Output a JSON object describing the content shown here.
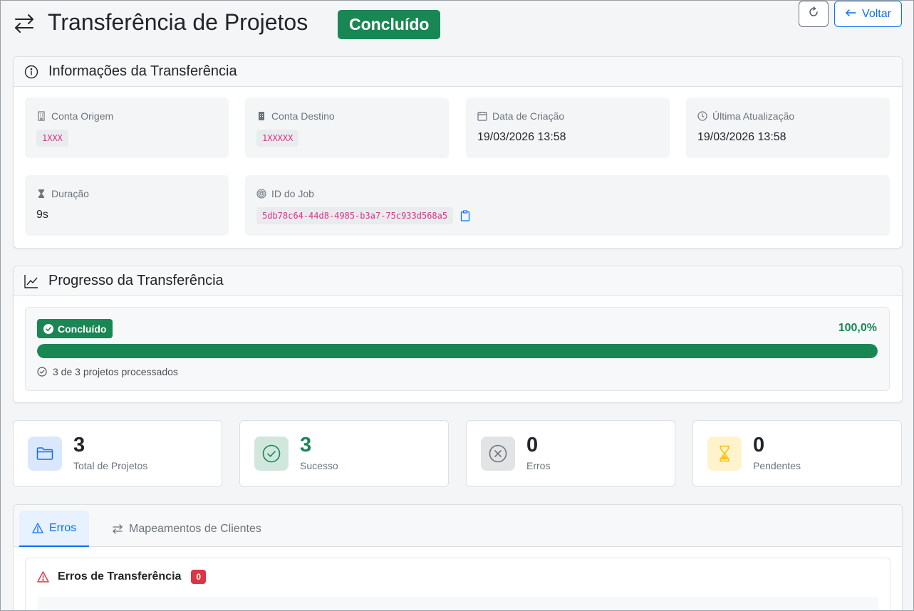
{
  "header": {
    "title": "Transferência de Projetos",
    "status": "Concluído",
    "back_label": "Voltar"
  },
  "info": {
    "title": "Informações da Transferência",
    "origin_label": "Conta Origem",
    "origin_value": "1XXX",
    "dest_label": "Conta Destino",
    "dest_value": "1XXXXX",
    "created_label": "Data de Criação",
    "created_value": "19/03/2026 13:58",
    "updated_label": "Última Atualização",
    "updated_value": "19/03/2026 13:58",
    "duration_label": "Duração",
    "duration_value": "9s",
    "job_label": "ID do Job",
    "job_value": "5db78c64-44d8-4985-b3a7-75c933d568a5"
  },
  "progress": {
    "title": "Progresso da Transferência",
    "badge": "Concluído",
    "percent_text": "100,0%",
    "fraction": 1.0,
    "summary": "3 de 3 projetos processados"
  },
  "stats": [
    {
      "value": "3",
      "label": "Total de Projetos",
      "icon": "folder-icon"
    },
    {
      "value": "3",
      "label": "Sucesso",
      "icon": "check-circle-icon"
    },
    {
      "value": "0",
      "label": "Erros",
      "icon": "x-circle-icon"
    },
    {
      "value": "0",
      "label": "Pendentes",
      "icon": "hourglass-icon"
    }
  ],
  "tabs": {
    "errors_label": "Erros",
    "mappings_label": "Mapeamentos de Clientes"
  },
  "errors": {
    "title": "Erros de Transferência",
    "count": "0"
  },
  "colors": {
    "success": "#198754",
    "primary": "#0d6efd",
    "danger": "#dc3545",
    "warning": "#ffc107"
  }
}
